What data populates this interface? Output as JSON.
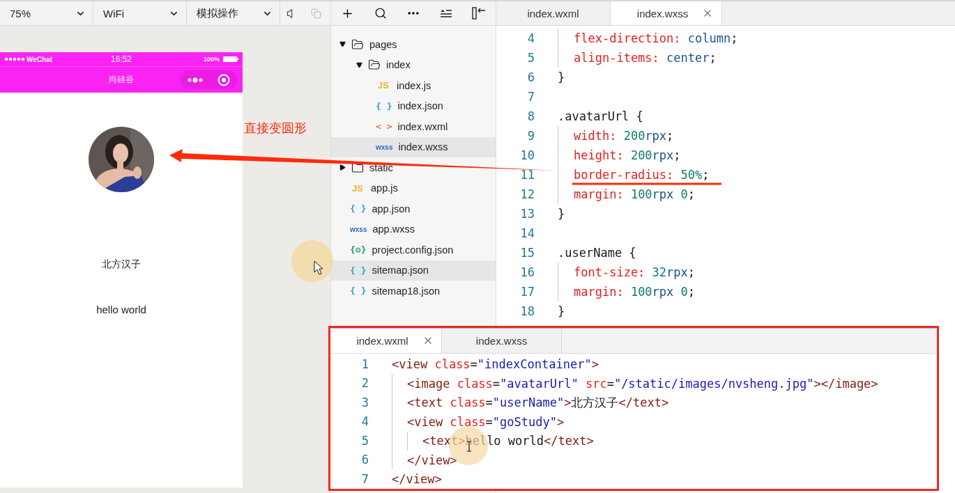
{
  "simulator_toolbar": {
    "dropdowns": [
      {
        "label": "75%"
      },
      {
        "label": "WiFi"
      },
      {
        "label": "模拟操作"
      }
    ]
  },
  "phone": {
    "status_bar": {
      "carrier": "WeChat",
      "time": "16:52",
      "battery": "100%"
    },
    "nav_bar": {
      "title": "尚硅谷"
    },
    "user_name": "北方汉子",
    "text": "hello world"
  },
  "annotation": {
    "label": "直接变圆形"
  },
  "file_tree": [
    {
      "name": "pages",
      "kind": "folder",
      "expanded": true,
      "children": [
        {
          "name": "index",
          "kind": "folder",
          "expanded": true,
          "children": [
            {
              "name": "index.js",
              "kind": "js",
              "icon": "JS",
              "selected": false
            },
            {
              "name": "index.json",
              "kind": "json",
              "icon": "{ }",
              "selected": false
            },
            {
              "name": "index.wxml",
              "kind": "wxml",
              "icon": "< >",
              "selected": false
            },
            {
              "name": "index.wxss",
              "kind": "wxss",
              "icon": "wxss",
              "selected": true
            }
          ]
        }
      ]
    },
    {
      "name": "static",
      "kind": "folder",
      "expanded": false
    },
    {
      "name": "app.js",
      "kind": "js",
      "icon": "JS",
      "selected": false
    },
    {
      "name": "app.json",
      "kind": "json",
      "icon": "{ }",
      "selected": false
    },
    {
      "name": "app.wxss",
      "kind": "wxss",
      "icon": "wxss",
      "selected": false
    },
    {
      "name": "project.config.json",
      "kind": "config",
      "icon": "{⚙}",
      "selected": false
    },
    {
      "name": "sitemap.json",
      "kind": "json",
      "icon": "{ }",
      "selected": true
    },
    {
      "name": "sitemap18.json",
      "kind": "json",
      "icon": "{ }",
      "selected": false
    }
  ],
  "editor": {
    "tabs": [
      {
        "label": "index.wxml",
        "selected": false
      },
      {
        "label": "index.wxss",
        "selected": true
      }
    ],
    "lines": [
      {
        "kind": "continuation",
        "children": [
          {
            "kind": "line",
            "number": "4",
            "tokens": [
              {
                "kind": "prop",
                "text": "flex-direction:"
              },
              {
                "kind": "keyword",
                "text": " column"
              },
              {
                "kind": "punct",
                "text": ";"
              }
            ]
          },
          {
            "kind": "line",
            "number": "5",
            "tokens": [
              {
                "kind": "prop",
                "text": "align-items:"
              },
              {
                "kind": "keyword",
                "text": " center"
              },
              {
                "kind": "punct",
                "text": ";"
              }
            ]
          }
        ]
      },
      {
        "kind": "line",
        "number": "6",
        "tokens": [
          {
            "kind": "punct",
            "text": "}"
          }
        ]
      },
      {
        "kind": "line",
        "number": "7"
      },
      {
        "kind": "line",
        "number": "8",
        "tokens": [
          {
            "kind": "punct",
            "text": ".avatarUrl {"
          }
        ],
        "children": [
          {
            "kind": "line",
            "number": "9",
            "tokens": [
              {
                "kind": "prop",
                "text": "width:"
              },
              {
                "kind": "number",
                "text": " 200"
              },
              {
                "kind": "keyword",
                "text": "rpx"
              },
              {
                "kind": "punct",
                "text": ";"
              }
            ]
          },
          {
            "kind": "line",
            "number": "10",
            "tokens": [
              {
                "kind": "prop",
                "text": "height:"
              },
              {
                "kind": "number",
                "text": " 200"
              },
              {
                "kind": "keyword",
                "text": "rpx"
              },
              {
                "kind": "punct",
                "text": ";"
              }
            ]
          },
          {
            "kind": "line",
            "number": "11",
            "tokens": [
              {
                "kind": "prop",
                "text": "border-radius:"
              },
              {
                "kind": "number",
                "text": " 50%"
              },
              {
                "kind": "punct",
                "text": ";"
              }
            ]
          },
          {
            "kind": "line",
            "number": "12",
            "tokens": [
              {
                "kind": "prop",
                "text": "margin:"
              },
              {
                "kind": "number",
                "text": " 100"
              },
              {
                "kind": "keyword",
                "text": "rpx"
              },
              {
                "kind": "number",
                "text": " 0"
              },
              {
                "kind": "punct",
                "text": ";"
              }
            ]
          }
        ]
      },
      {
        "kind": "line",
        "number": "13",
        "tokens": [
          {
            "kind": "punct",
            "text": "}"
          }
        ]
      },
      {
        "kind": "line",
        "number": "14"
      },
      {
        "kind": "line",
        "number": "15",
        "tokens": [
          {
            "kind": "punct",
            "text": ".userName {"
          }
        ],
        "children": [
          {
            "kind": "line",
            "number": "16",
            "tokens": [
              {
                "kind": "prop",
                "text": "font-size:"
              },
              {
                "kind": "number",
                "text": " 32"
              },
              {
                "kind": "keyword",
                "text": "rpx"
              },
              {
                "kind": "punct",
                "text": ";"
              }
            ]
          },
          {
            "kind": "line",
            "number": "17",
            "tokens": [
              {
                "kind": "prop",
                "text": "margin:"
              },
              {
                "kind": "number",
                "text": " 100"
              },
              {
                "kind": "keyword",
                "text": "rpx"
              },
              {
                "kind": "number",
                "text": " 0"
              },
              {
                "kind": "punct",
                "text": ";"
              }
            ]
          }
        ]
      },
      {
        "kind": "line",
        "number": "18",
        "tokens": [
          {
            "kind": "punct",
            "text": "}"
          }
        ]
      }
    ]
  },
  "bottom_editor": {
    "tabs": [
      {
        "label": "index.wxml",
        "selected": true
      },
      {
        "label": "index.wxss",
        "selected": false
      }
    ],
    "lines": [
      {
        "kind": "line",
        "number": "1",
        "tokens": [
          {
            "kind": "tag",
            "text": "<view "
          },
          {
            "kind": "attr",
            "text": "class"
          },
          {
            "kind": "punct",
            "text": "="
          },
          {
            "kind": "string",
            "text": "\"indexContainer\""
          },
          {
            "kind": "tag",
            "text": ">"
          }
        ],
        "children": [
          {
            "kind": "line",
            "number": "2",
            "tokens": [
              {
                "kind": "tag",
                "text": "<image "
              },
              {
                "kind": "attr",
                "text": "class"
              },
              {
                "kind": "punct",
                "text": "="
              },
              {
                "kind": "string",
                "text": "\"avatarUrl\" "
              },
              {
                "kind": "attr",
                "text": "src"
              },
              {
                "kind": "punct",
                "text": "="
              },
              {
                "kind": "string",
                "text": "\"/static/images/nvsheng.jpg\""
              },
              {
                "kind": "tag",
                "text": "></image>"
              }
            ]
          },
          {
            "kind": "line",
            "number": "3",
            "tokens": [
              {
                "kind": "tag",
                "text": "<text "
              },
              {
                "kind": "attr",
                "text": "class"
              },
              {
                "kind": "punct",
                "text": "="
              },
              {
                "kind": "string",
                "text": "\"userName\""
              },
              {
                "kind": "tag",
                "text": ">"
              },
              {
                "kind": "text",
                "text": "北方汉子"
              },
              {
                "kind": "tag",
                "text": "</text>"
              }
            ]
          },
          {
            "kind": "line",
            "number": "4",
            "tokens": [
              {
                "kind": "tag",
                "text": "<view "
              },
              {
                "kind": "attr",
                "text": "class"
              },
              {
                "kind": "punct",
                "text": "="
              },
              {
                "kind": "string",
                "text": "\"goStudy\""
              },
              {
                "kind": "tag",
                "text": ">"
              }
            ],
            "children": [
              {
                "kind": "line",
                "number": "5",
                "tokens": [
                  {
                    "kind": "tag",
                    "text": "<text>"
                  },
                  {
                    "kind": "text",
                    "text": "hello world"
                  },
                  {
                    "kind": "tag",
                    "text": "</text>"
                  }
                ]
              }
            ]
          },
          {
            "kind": "line",
            "number": "6",
            "tokens": [
              {
                "kind": "tag",
                "text": "</view>"
              }
            ]
          }
        ]
      },
      {
        "kind": "line",
        "number": "7",
        "tokens": [
          {
            "kind": "tag",
            "text": "</view>"
          }
        ]
      }
    ]
  }
}
